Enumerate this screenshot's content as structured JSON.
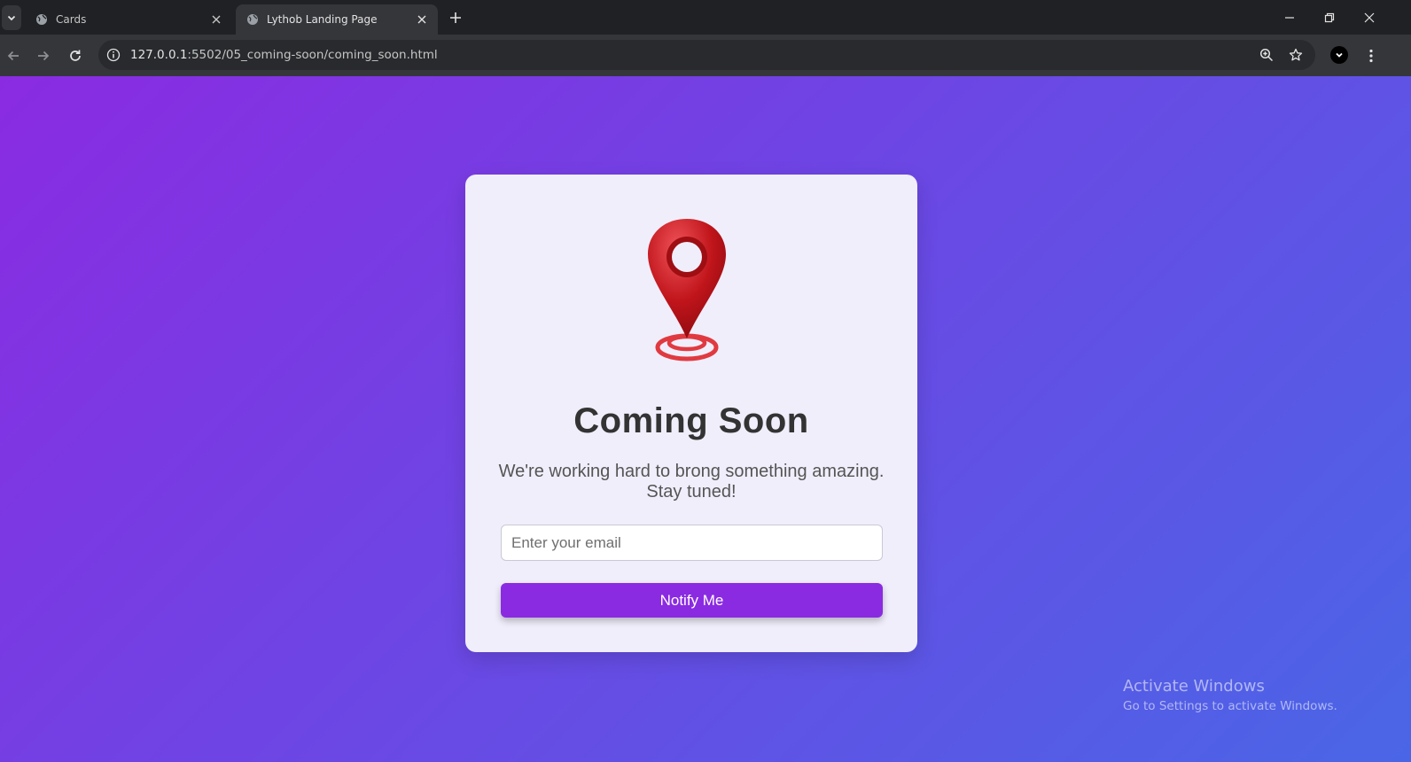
{
  "browser": {
    "tabs": [
      {
        "title": "Cards",
        "active": false
      },
      {
        "title": "Lythob Landing Page",
        "active": true
      }
    ],
    "address": {
      "host": "127.0.0.1",
      "path": ":5502/05_coming-soon/coming_soon.html"
    }
  },
  "page": {
    "heading": "Coming Soon",
    "subtext_line1": "We're working hard to brong something amazing.",
    "subtext_line2": "Stay tuned!",
    "email_placeholder": "Enter your email",
    "email_value": "",
    "button_label": "Notify Me",
    "colors": {
      "gradient_start": "#8a2be2",
      "gradient_end": "#4a66e6",
      "card_bg": "#f0eefb",
      "button_bg": "#8a2be2",
      "pin": "#c0151b"
    },
    "icon": "location-pin-icon"
  },
  "os_watermark": {
    "line1": "Activate Windows",
    "line2": "Go to Settings to activate Windows."
  }
}
